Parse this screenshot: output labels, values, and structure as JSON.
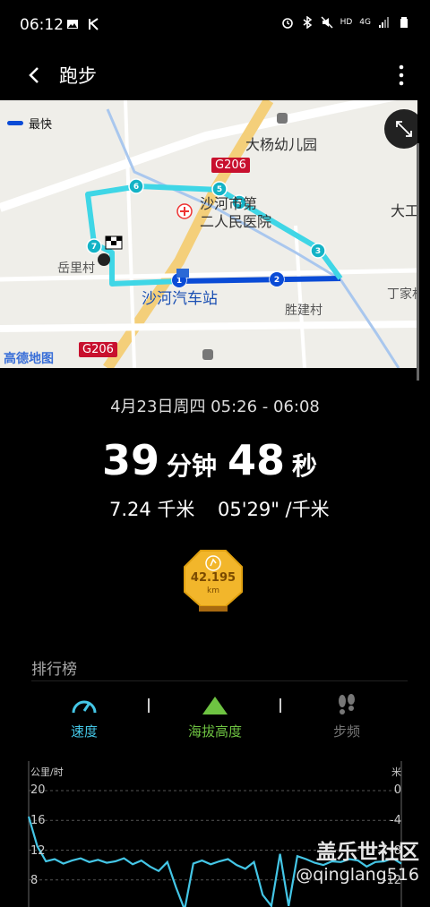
{
  "status": {
    "time": "06:12",
    "hd": "HD",
    "net": "4G"
  },
  "header": {
    "title": "跑步"
  },
  "map": {
    "legend": "最快",
    "labels": {
      "kindergarten": "大杨幼儿园",
      "road1": "G206",
      "hospital_a": "沙河市第",
      "hospital_b": "二人民医院",
      "village_yueli": "岳里村",
      "station": "沙河汽车站",
      "village_shengjian": "胜建村",
      "village_dinghjia": "丁家村",
      "village_dagong": "大工小",
      "road2": "G206",
      "logo": "高德地图"
    },
    "markers": [
      "1",
      "2",
      "3",
      "4",
      "5",
      "6",
      "7"
    ],
    "colors": {
      "route": "#3fd6e6",
      "fast": "#0a4bd6"
    }
  },
  "summary": {
    "date": "4月23日周四 05:26 - 06:08",
    "minutes": "39",
    "minutes_unit": "分钟",
    "seconds": "48",
    "seconds_unit": "秒",
    "distance": "7.24 千米",
    "pace": "05'29\" /千米"
  },
  "badge": {
    "value": "42.195",
    "unit": "km"
  },
  "ranking": {
    "title": "排行榜",
    "tabs": [
      {
        "label": "速度",
        "color": "#44c6e6"
      },
      {
        "label": "海拔高度",
        "color": "#6ec342"
      },
      {
        "label": "步频",
        "color": "#777777"
      }
    ]
  },
  "chart_data": {
    "type": "line",
    "ylabel": "公里/时",
    "ylabel_right": "米",
    "left_ticks": [
      "20",
      "16",
      "12",
      "8"
    ],
    "right_ticks": [
      "0",
      "-4",
      "-8",
      "-12"
    ],
    "ylim": [
      4,
      20
    ],
    "series": [
      {
        "values": [
          16.5,
          12.5,
          10.5,
          10.8,
          10.2,
          10.6,
          10.9,
          10.4,
          10.7,
          10.3,
          10.5,
          10.9,
          10.1,
          10.6,
          9.8,
          9.2,
          10.4,
          7.0,
          4.0,
          10.2,
          10.6,
          10.1,
          10.5,
          10.8,
          10.0,
          9.5,
          10.4,
          6.0,
          4.5,
          11.5,
          4.5,
          11.2,
          10.8,
          10.3,
          10.0,
          10.5,
          10.4,
          10.8,
          10.6,
          9.8,
          10.4,
          10.5,
          10.9,
          10.2
        ]
      }
    ]
  },
  "watermark": {
    "line1": "盖乐世社区",
    "line2": "@qinglang516"
  }
}
